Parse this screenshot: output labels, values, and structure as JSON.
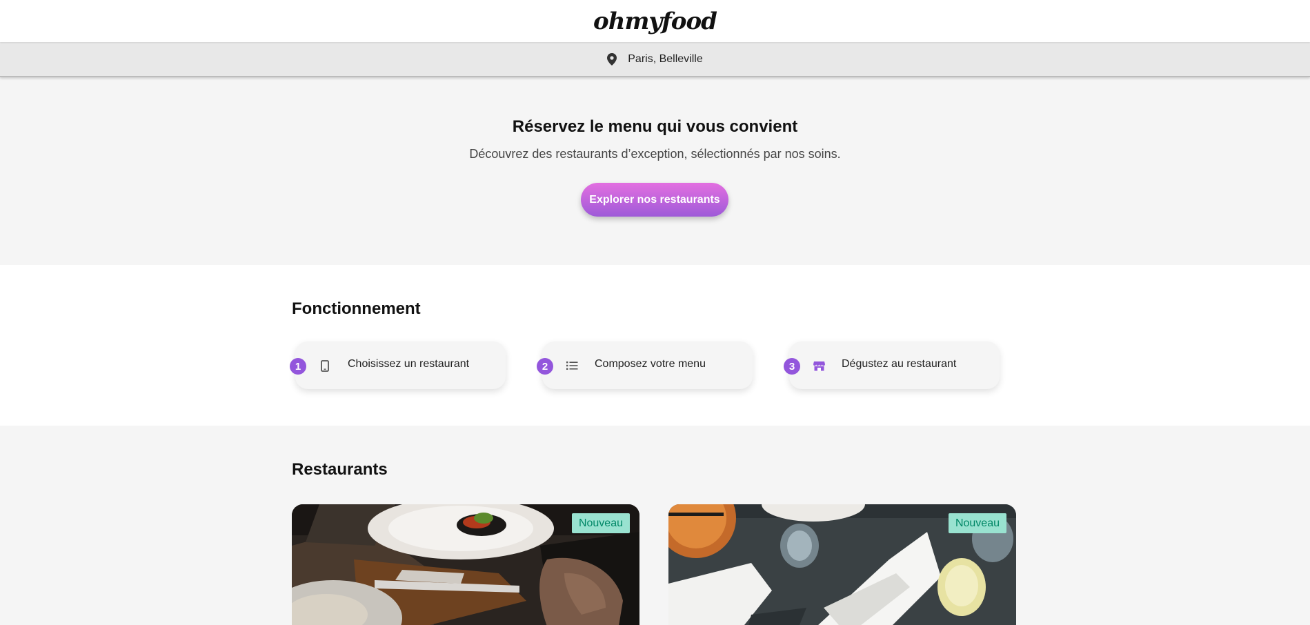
{
  "header": {
    "logo": "ohmyfood"
  },
  "location": {
    "text": "Paris, Belleville",
    "icon": "map-pin-icon"
  },
  "hero": {
    "title": "Réservez le menu qui vous convient",
    "subtitle": "Découvrez des restaurants d’exception, sélectionnés par nos soins.",
    "cta_label": "Explorer nos restaurants"
  },
  "how": {
    "title": "Fonctionnement",
    "steps": [
      {
        "number": "1",
        "label": "Choisissez un restaurant",
        "icon": "phone-icon"
      },
      {
        "number": "2",
        "label": "Composez votre menu",
        "icon": "list-icon"
      },
      {
        "number": "3",
        "label": "Dégustez au restaurant",
        "icon": "store-icon"
      }
    ]
  },
  "restaurants": {
    "title": "Restaurants",
    "cards": [
      {
        "badge": "Nouveau"
      },
      {
        "badge": "Nouveau"
      }
    ]
  },
  "colors": {
    "accent_start": "#e36fe0",
    "accent_end": "#9e5ad8",
    "step_number": "#9356dc",
    "badge_bg": "#99e2d0",
    "badge_text": "#008766"
  }
}
